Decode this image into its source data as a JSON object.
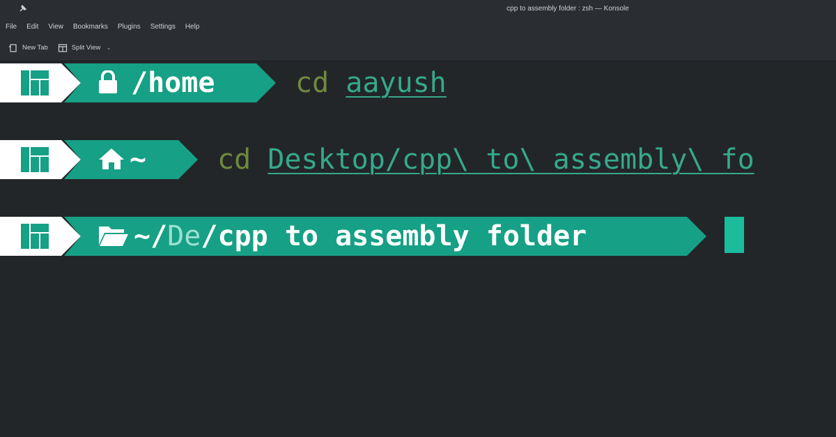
{
  "window": {
    "title": "cpp to assembly folder : zsh — Konsole"
  },
  "menubar": {
    "items": [
      "File",
      "Edit",
      "View",
      "Bookmarks",
      "Plugins",
      "Settings",
      "Help"
    ]
  },
  "toolbar": {
    "new_tab": "New Tab",
    "split_view": "Split View"
  },
  "terminal": {
    "lines": [
      {
        "path_icon": "lock-icon",
        "path": "/home",
        "command": "cd",
        "argument": "aayush"
      },
      {
        "path_icon": "home-icon",
        "path": "~",
        "command": "cd",
        "argument": "Desktop/cpp\\ to\\ assembly\\ fo"
      },
      {
        "path_icon": "folder-open-icon",
        "path_prefix": "~/",
        "path_dim": "De",
        "path_sep": "/",
        "path": "cpp to assembly folder",
        "command": "",
        "argument": ""
      }
    ],
    "colors": {
      "background": "#232629",
      "segment": "#16a085",
      "logo_segment": "#ffffff",
      "cursor": "#1abc9c",
      "command": "#6f8a3c",
      "argument": "#35a98b"
    }
  }
}
